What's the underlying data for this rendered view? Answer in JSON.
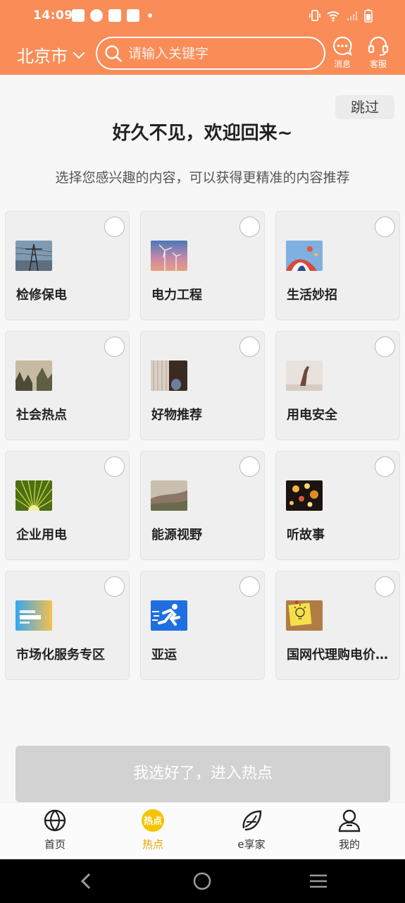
{
  "status_bar": {
    "time": "14:09"
  },
  "header": {
    "city": "北京市",
    "search_placeholder": "请输入关键字",
    "messages_label": "消息",
    "service_label": "客服"
  },
  "skip_label": "跳过",
  "title": "好久不见，欢迎回来~",
  "subtitle": "选择您感兴趣的内容，可以获得更精准的内容推荐",
  "categories": [
    {
      "label": "检修保电",
      "icon": "power-tower-photo"
    },
    {
      "label": "电力工程",
      "icon": "wind-turbine-photo"
    },
    {
      "label": "生活妙招",
      "icon": "hot-air-balloon-photo"
    },
    {
      "label": "社会热点",
      "icon": "misty-forest-photo"
    },
    {
      "label": "好物推荐",
      "icon": "curtain-vase-photo"
    },
    {
      "label": "用电安全",
      "icon": "raised-hand-photo"
    },
    {
      "label": "企业用电",
      "icon": "sunburst-leaf-photo"
    },
    {
      "label": "能源视野",
      "icon": "desert-landscape-photo"
    },
    {
      "label": "听故事",
      "icon": "bokeh-lights-photo"
    },
    {
      "label": "市场化服务专区",
      "icon": "online-hall-banner"
    },
    {
      "label": "亚运",
      "icon": "running-man-icon"
    },
    {
      "label": "国网代理购电价格...",
      "icon": "lightbulb-note-photo"
    }
  ],
  "confirm_label": "我选好了，进入热点",
  "bottom_nav": [
    {
      "label": "首页",
      "icon": "globe-icon"
    },
    {
      "label": "热点",
      "icon": "hot-badge-icon"
    },
    {
      "label": "e享家",
      "icon": "e-leaf-icon"
    },
    {
      "label": "我的",
      "icon": "user-icon"
    }
  ],
  "colors": {
    "brand": "#f98c57",
    "active": "#e8a400"
  }
}
